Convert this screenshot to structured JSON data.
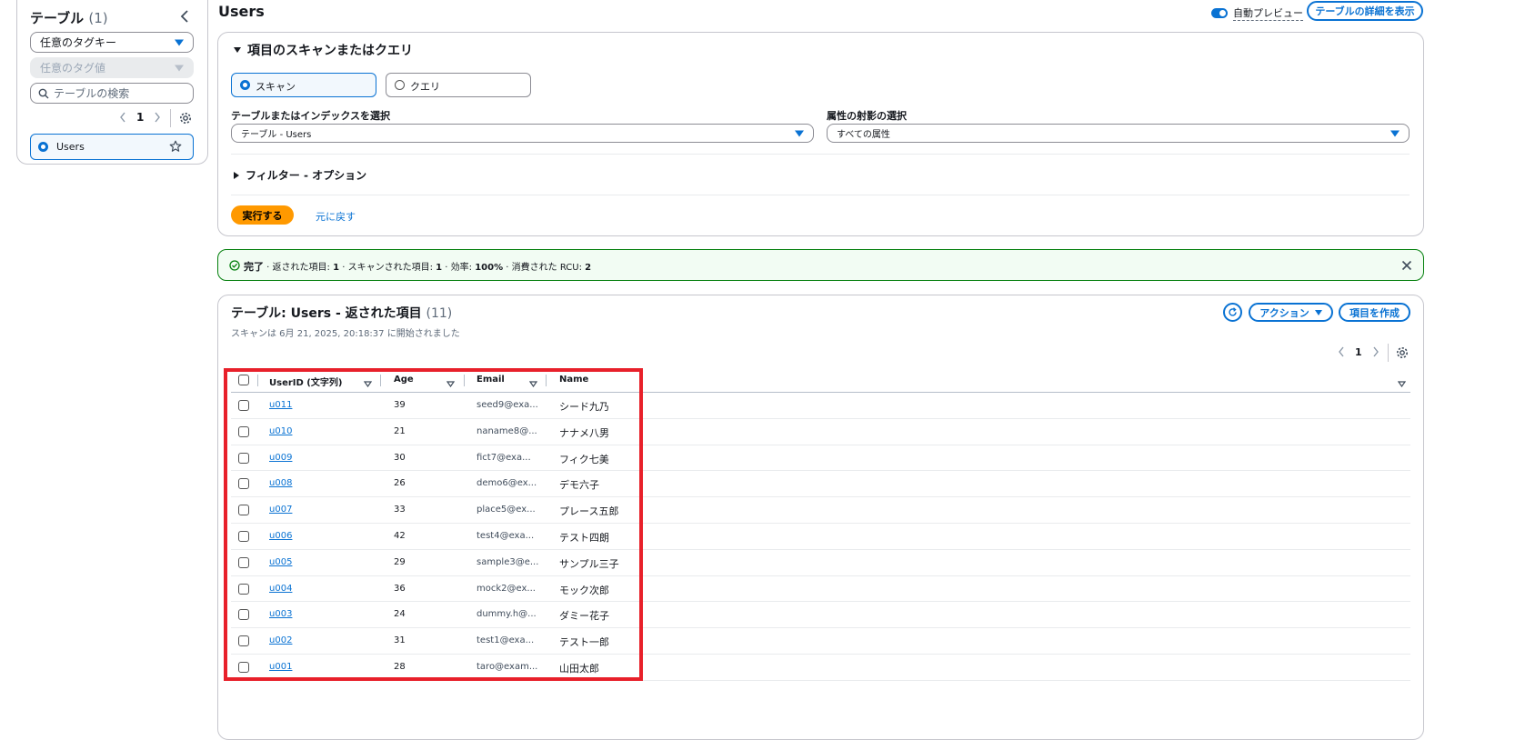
{
  "sidebar": {
    "title": "テーブル",
    "count": "(1)",
    "tag_key_placeholder": "任意のタグキー",
    "tag_value_placeholder": "任意のタグ値",
    "search_placeholder": "テーブルの検索",
    "page": "1",
    "tables": [
      {
        "name": "Users"
      }
    ]
  },
  "header": {
    "title": "Users",
    "auto_preview_label": "自動プレビュー",
    "details_button": "テーブルの詳細を表示"
  },
  "scan_panel": {
    "title": "項目のスキャンまたはクエリ",
    "scan_label": "スキャン",
    "query_label": "クエリ",
    "table_index_label": "テーブルまたはインデックスを選択",
    "table_index_value": "テーブル - Users",
    "projection_label": "属性の射影の選択",
    "projection_value": "すべての属性",
    "filter_label": "フィルター - オプション",
    "run_button": "実行する",
    "reset_link": "元に戻す"
  },
  "status": {
    "strong": "完了",
    "s1": " · 返された項目: ",
    "v1": "1",
    "s2": " · スキャンされた項目: ",
    "v2": "1",
    "s3": " · 効率: ",
    "v3": "100%",
    "s4": " · 消費された RCU: ",
    "v4": "2"
  },
  "results": {
    "title": "テーブル: Users - 返された項目",
    "count": "(11)",
    "subtitle": "スキャンは 6月 21, 2025, 20:18:37 に開始されました",
    "actions_button": "アクション",
    "create_button": "項目を作成",
    "page": "1",
    "columns": [
      "UserID (文字列)",
      "Age",
      "Email",
      "Name"
    ],
    "rows": [
      {
        "id": "u011",
        "age": "39",
        "email": "seed9@exa...",
        "name": "シード九乃"
      },
      {
        "id": "u010",
        "age": "21",
        "email": "naname8@...",
        "name": "ナナメ八男"
      },
      {
        "id": "u009",
        "age": "30",
        "email": "fict7@exa...",
        "name": "フィク七美"
      },
      {
        "id": "u008",
        "age": "26",
        "email": "demo6@ex...",
        "name": "デモ六子"
      },
      {
        "id": "u007",
        "age": "33",
        "email": "place5@ex...",
        "name": "プレース五郎"
      },
      {
        "id": "u006",
        "age": "42",
        "email": "test4@exa...",
        "name": "テスト四朗"
      },
      {
        "id": "u005",
        "age": "29",
        "email": "sample3@e...",
        "name": "サンプル三子"
      },
      {
        "id": "u004",
        "age": "36",
        "email": "mock2@ex...",
        "name": "モック次郎"
      },
      {
        "id": "u003",
        "age": "24",
        "email": "dummy.h@...",
        "name": "ダミー花子"
      },
      {
        "id": "u002",
        "age": "31",
        "email": "test1@exa...",
        "name": "テスト一郎"
      },
      {
        "id": "u001",
        "age": "28",
        "email": "taro@exam...",
        "name": "山田太郎"
      }
    ]
  },
  "colors": {
    "accent": "#0972d3",
    "run_button": "#ff9900",
    "success_bg": "#f2fcf3",
    "success_border": "#037f0c",
    "highlight_box": "#e8202a"
  }
}
